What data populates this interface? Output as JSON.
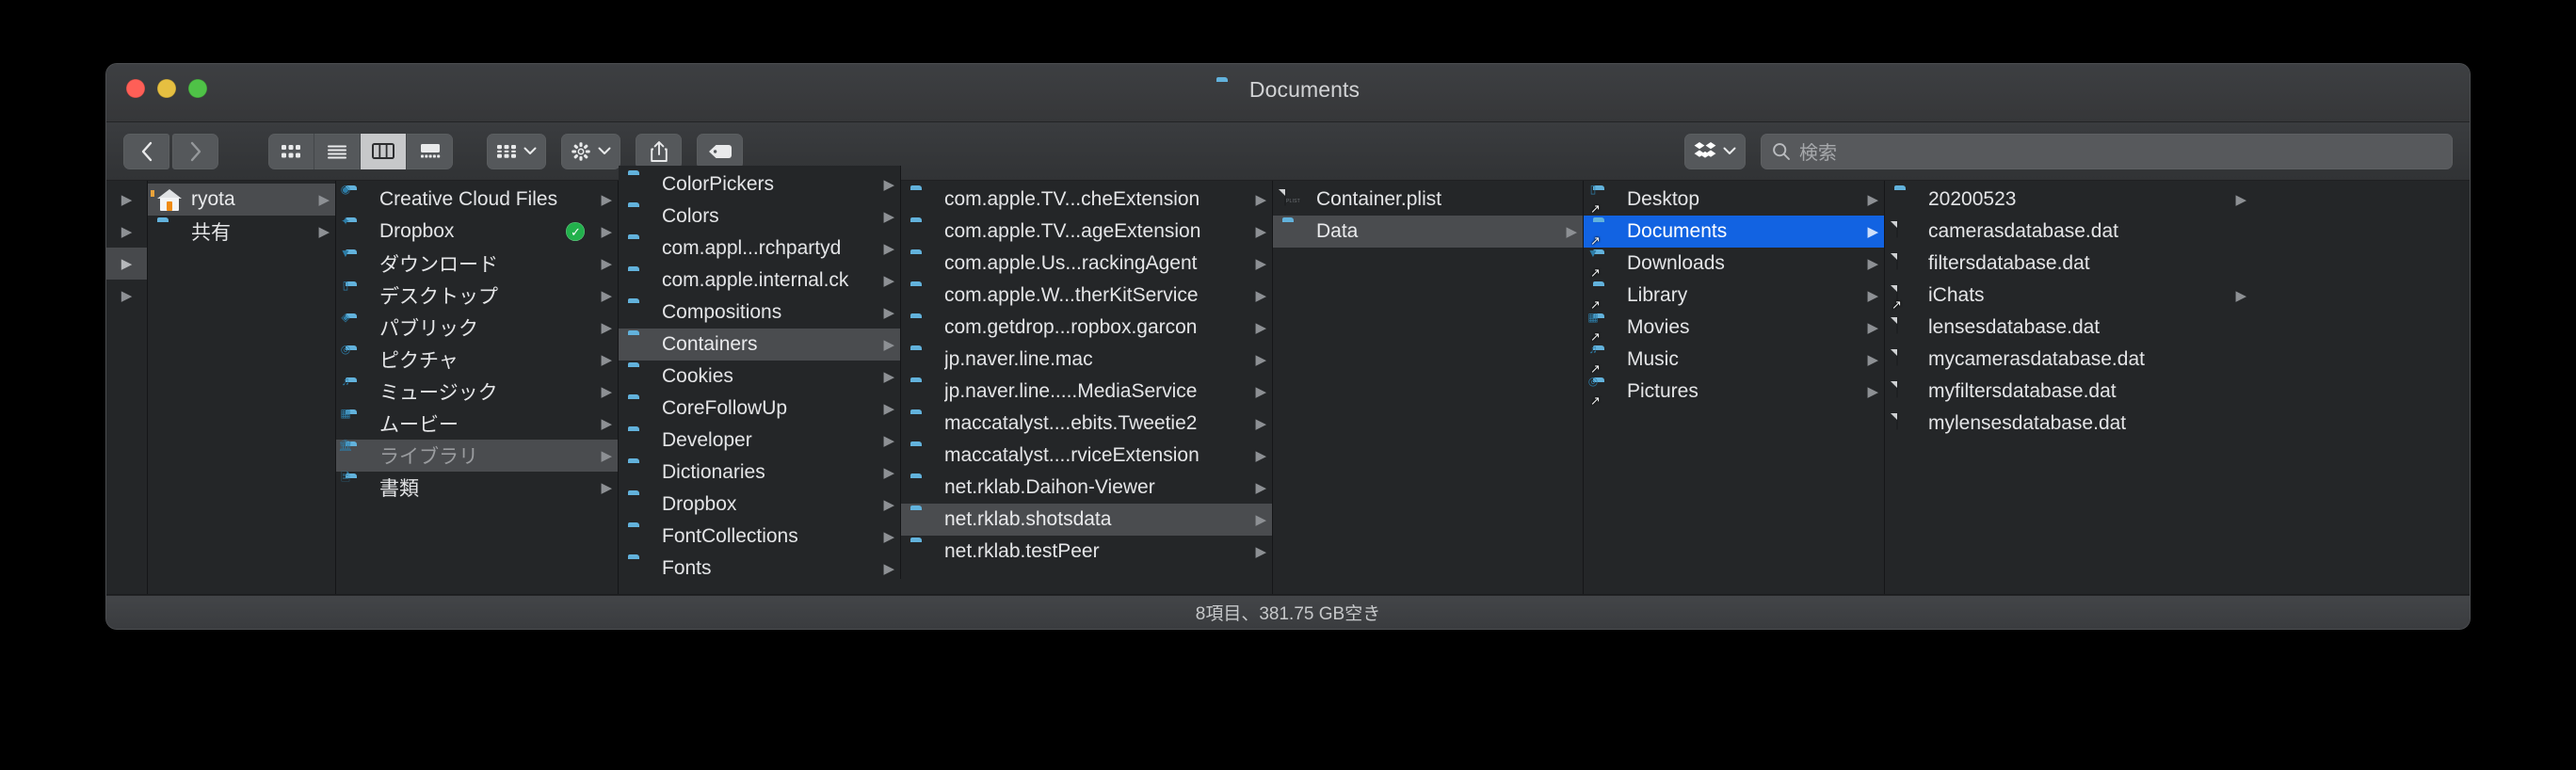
{
  "window": {
    "title": "Documents",
    "title_icon": "folder-icon"
  },
  "traffic_lights": {
    "close": "close-button",
    "minimize": "minimize-button",
    "maximize": "maximize-button"
  },
  "toolbar": {
    "back": "back-button",
    "forward": "forward-button",
    "view_modes": [
      {
        "name": "icon-view",
        "icon": "grid-icon",
        "active": false
      },
      {
        "name": "list-view",
        "icon": "list-icon",
        "active": false
      },
      {
        "name": "column-view",
        "icon": "columns-icon",
        "active": true
      },
      {
        "name": "gallery-view",
        "icon": "gallery-icon",
        "active": false
      }
    ],
    "group_button": "group-by-button",
    "action_button": "action-gear-button",
    "share_button": "share-button",
    "tag_button": "tag-button",
    "dropbox_button": "dropbox-button"
  },
  "search": {
    "placeholder": "検索",
    "value": ""
  },
  "statusbar": {
    "text": "8項目、381.75 GB空き"
  },
  "colors": {
    "selection_active": "#1263e2",
    "selection_inactive": "#4a4c4f",
    "folder_blue": "#4ea6d6",
    "sync_green": "#22b14c"
  },
  "columns": [
    {
      "name": "column-0-stub",
      "stub": true,
      "rows": [
        {
          "arrow": true,
          "highlight": false
        },
        {
          "arrow": true,
          "highlight": false
        },
        {
          "arrow": true,
          "highlight": true
        },
        {
          "arrow": true,
          "highlight": false
        }
      ]
    },
    {
      "name": "column-1-users",
      "items": [
        {
          "label": "ryota",
          "icon": "home-icon",
          "arrow": true,
          "state": "selected-inactive"
        },
        {
          "label": "共有",
          "icon": "folder-icon",
          "arrow": true,
          "state": "normal"
        }
      ]
    },
    {
      "name": "column-2-home",
      "items": [
        {
          "label": "Creative Cloud Files",
          "icon": "folder-creative-cloud-icon",
          "arrow": true,
          "state": "normal"
        },
        {
          "label": "Dropbox",
          "icon": "folder-dropbox-icon",
          "arrow": true,
          "badge": "sync-check-icon",
          "state": "normal"
        },
        {
          "label": "ダウンロード",
          "icon": "folder-downloads-icon",
          "arrow": true,
          "state": "normal"
        },
        {
          "label": "デスクトップ",
          "icon": "folder-desktop-icon",
          "arrow": true,
          "state": "normal"
        },
        {
          "label": "パブリック",
          "icon": "folder-public-icon",
          "arrow": true,
          "state": "normal"
        },
        {
          "label": "ピクチャ",
          "icon": "folder-pictures-icon",
          "arrow": true,
          "state": "normal"
        },
        {
          "label": "ミュージック",
          "icon": "folder-music-icon",
          "arrow": true,
          "state": "normal"
        },
        {
          "label": "ムービー",
          "icon": "folder-movies-icon",
          "arrow": true,
          "state": "normal"
        },
        {
          "label": "ライブラリ",
          "icon": "folder-library-icon",
          "arrow": true,
          "state": "selected-dim"
        },
        {
          "label": "書類",
          "icon": "folder-documents-icon",
          "arrow": true,
          "state": "normal"
        }
      ]
    },
    {
      "name": "column-3-library",
      "clipped_top": true,
      "items": [
        {
          "label": "ColorPickers",
          "icon": "folder-icon",
          "arrow": true,
          "state": "normal"
        },
        {
          "label": "Colors",
          "icon": "folder-icon",
          "arrow": true,
          "state": "normal"
        },
        {
          "label": "com.appl...rchpartyd",
          "icon": "folder-icon",
          "arrow": true,
          "state": "normal"
        },
        {
          "label": "com.apple.internal.ck",
          "icon": "folder-icon",
          "arrow": true,
          "state": "normal"
        },
        {
          "label": "Compositions",
          "icon": "folder-icon",
          "arrow": true,
          "state": "normal"
        },
        {
          "label": "Containers",
          "icon": "folder-icon",
          "arrow": true,
          "state": "selected-inactive"
        },
        {
          "label": "Cookies",
          "icon": "folder-icon",
          "arrow": true,
          "state": "normal"
        },
        {
          "label": "CoreFollowUp",
          "icon": "folder-icon",
          "arrow": true,
          "state": "normal"
        },
        {
          "label": "Developer",
          "icon": "folder-icon",
          "arrow": true,
          "state": "normal"
        },
        {
          "label": "Dictionaries",
          "icon": "folder-icon",
          "arrow": true,
          "state": "normal"
        },
        {
          "label": "Dropbox",
          "icon": "folder-icon",
          "arrow": true,
          "state": "normal"
        },
        {
          "label": "FontCollections",
          "icon": "folder-icon",
          "arrow": true,
          "state": "normal"
        },
        {
          "label": "Fonts",
          "icon": "folder-icon",
          "arrow": true,
          "state": "normal"
        }
      ]
    },
    {
      "name": "column-4-containers",
      "items": [
        {
          "label": "com.apple.TV...cheExtension",
          "icon": "folder-icon",
          "arrow": true,
          "state": "normal"
        },
        {
          "label": "com.apple.TV...ageExtension",
          "icon": "folder-icon",
          "arrow": true,
          "state": "normal"
        },
        {
          "label": "com.apple.Us...rackingAgent",
          "icon": "folder-icon",
          "arrow": true,
          "state": "normal"
        },
        {
          "label": "com.apple.W...therKitService",
          "icon": "folder-icon",
          "arrow": true,
          "state": "normal"
        },
        {
          "label": "com.getdrop...ropbox.garcon",
          "icon": "folder-icon",
          "arrow": true,
          "state": "normal"
        },
        {
          "label": "jp.naver.line.mac",
          "icon": "folder-icon",
          "arrow": true,
          "state": "normal"
        },
        {
          "label": "jp.naver.line.....MediaService",
          "icon": "folder-icon",
          "arrow": true,
          "state": "normal"
        },
        {
          "label": "maccatalyst....ebits.Tweetie2",
          "icon": "folder-icon",
          "arrow": true,
          "state": "normal"
        },
        {
          "label": "maccatalyst....rviceExtension",
          "icon": "folder-icon",
          "arrow": true,
          "state": "normal"
        },
        {
          "label": "net.rklab.Daihon-Viewer",
          "icon": "folder-icon",
          "arrow": true,
          "state": "normal"
        },
        {
          "label": "net.rklab.shotsdata",
          "icon": "folder-icon",
          "arrow": true,
          "state": "selected-inactive"
        },
        {
          "label": "net.rklab.testPeer",
          "icon": "folder-icon",
          "arrow": true,
          "state": "normal"
        }
      ]
    },
    {
      "name": "column-5-shotsdata",
      "items": [
        {
          "label": "Container.plist",
          "icon": "plist-file-icon",
          "arrow": false,
          "state": "normal"
        },
        {
          "label": "Data",
          "icon": "folder-icon",
          "arrow": true,
          "state": "selected-inactive"
        }
      ]
    },
    {
      "name": "column-6-data",
      "items": [
        {
          "label": "Desktop",
          "icon": "folder-desktop-alias-icon",
          "arrow": true,
          "state": "normal"
        },
        {
          "label": "Documents",
          "icon": "folder-documents-alias-icon",
          "arrow": true,
          "state": "selected-active"
        },
        {
          "label": "Downloads",
          "icon": "folder-downloads-alias-icon",
          "arrow": true,
          "state": "normal"
        },
        {
          "label": "Library",
          "icon": "folder-library-alias-icon",
          "arrow": true,
          "state": "normal"
        },
        {
          "label": "Movies",
          "icon": "folder-movies-alias-icon",
          "arrow": true,
          "state": "normal"
        },
        {
          "label": "Music",
          "icon": "folder-music-alias-icon",
          "arrow": true,
          "state": "normal"
        },
        {
          "label": "Pictures",
          "icon": "folder-pictures-alias-icon",
          "arrow": true,
          "state": "normal"
        }
      ]
    },
    {
      "name": "column-7-documents",
      "items": [
        {
          "label": "20200523",
          "icon": "folder-icon",
          "arrow": true,
          "state": "normal"
        },
        {
          "label": "camerasdatabase.dat",
          "icon": "file-icon",
          "arrow": false,
          "state": "normal"
        },
        {
          "label": "filtersdatabase.dat",
          "icon": "file-icon",
          "arrow": false,
          "state": "normal"
        },
        {
          "label": "iChats",
          "icon": "file-alias-icon",
          "arrow": true,
          "state": "normal"
        },
        {
          "label": "lensesdatabase.dat",
          "icon": "file-icon",
          "arrow": false,
          "state": "normal"
        },
        {
          "label": "mycamerasdatabase.dat",
          "icon": "file-icon",
          "arrow": false,
          "state": "normal"
        },
        {
          "label": "myfiltersdatabase.dat",
          "icon": "file-icon",
          "arrow": false,
          "state": "normal"
        },
        {
          "label": "mylensesdatabase.dat",
          "icon": "file-icon",
          "arrow": false,
          "state": "normal"
        }
      ]
    }
  ]
}
